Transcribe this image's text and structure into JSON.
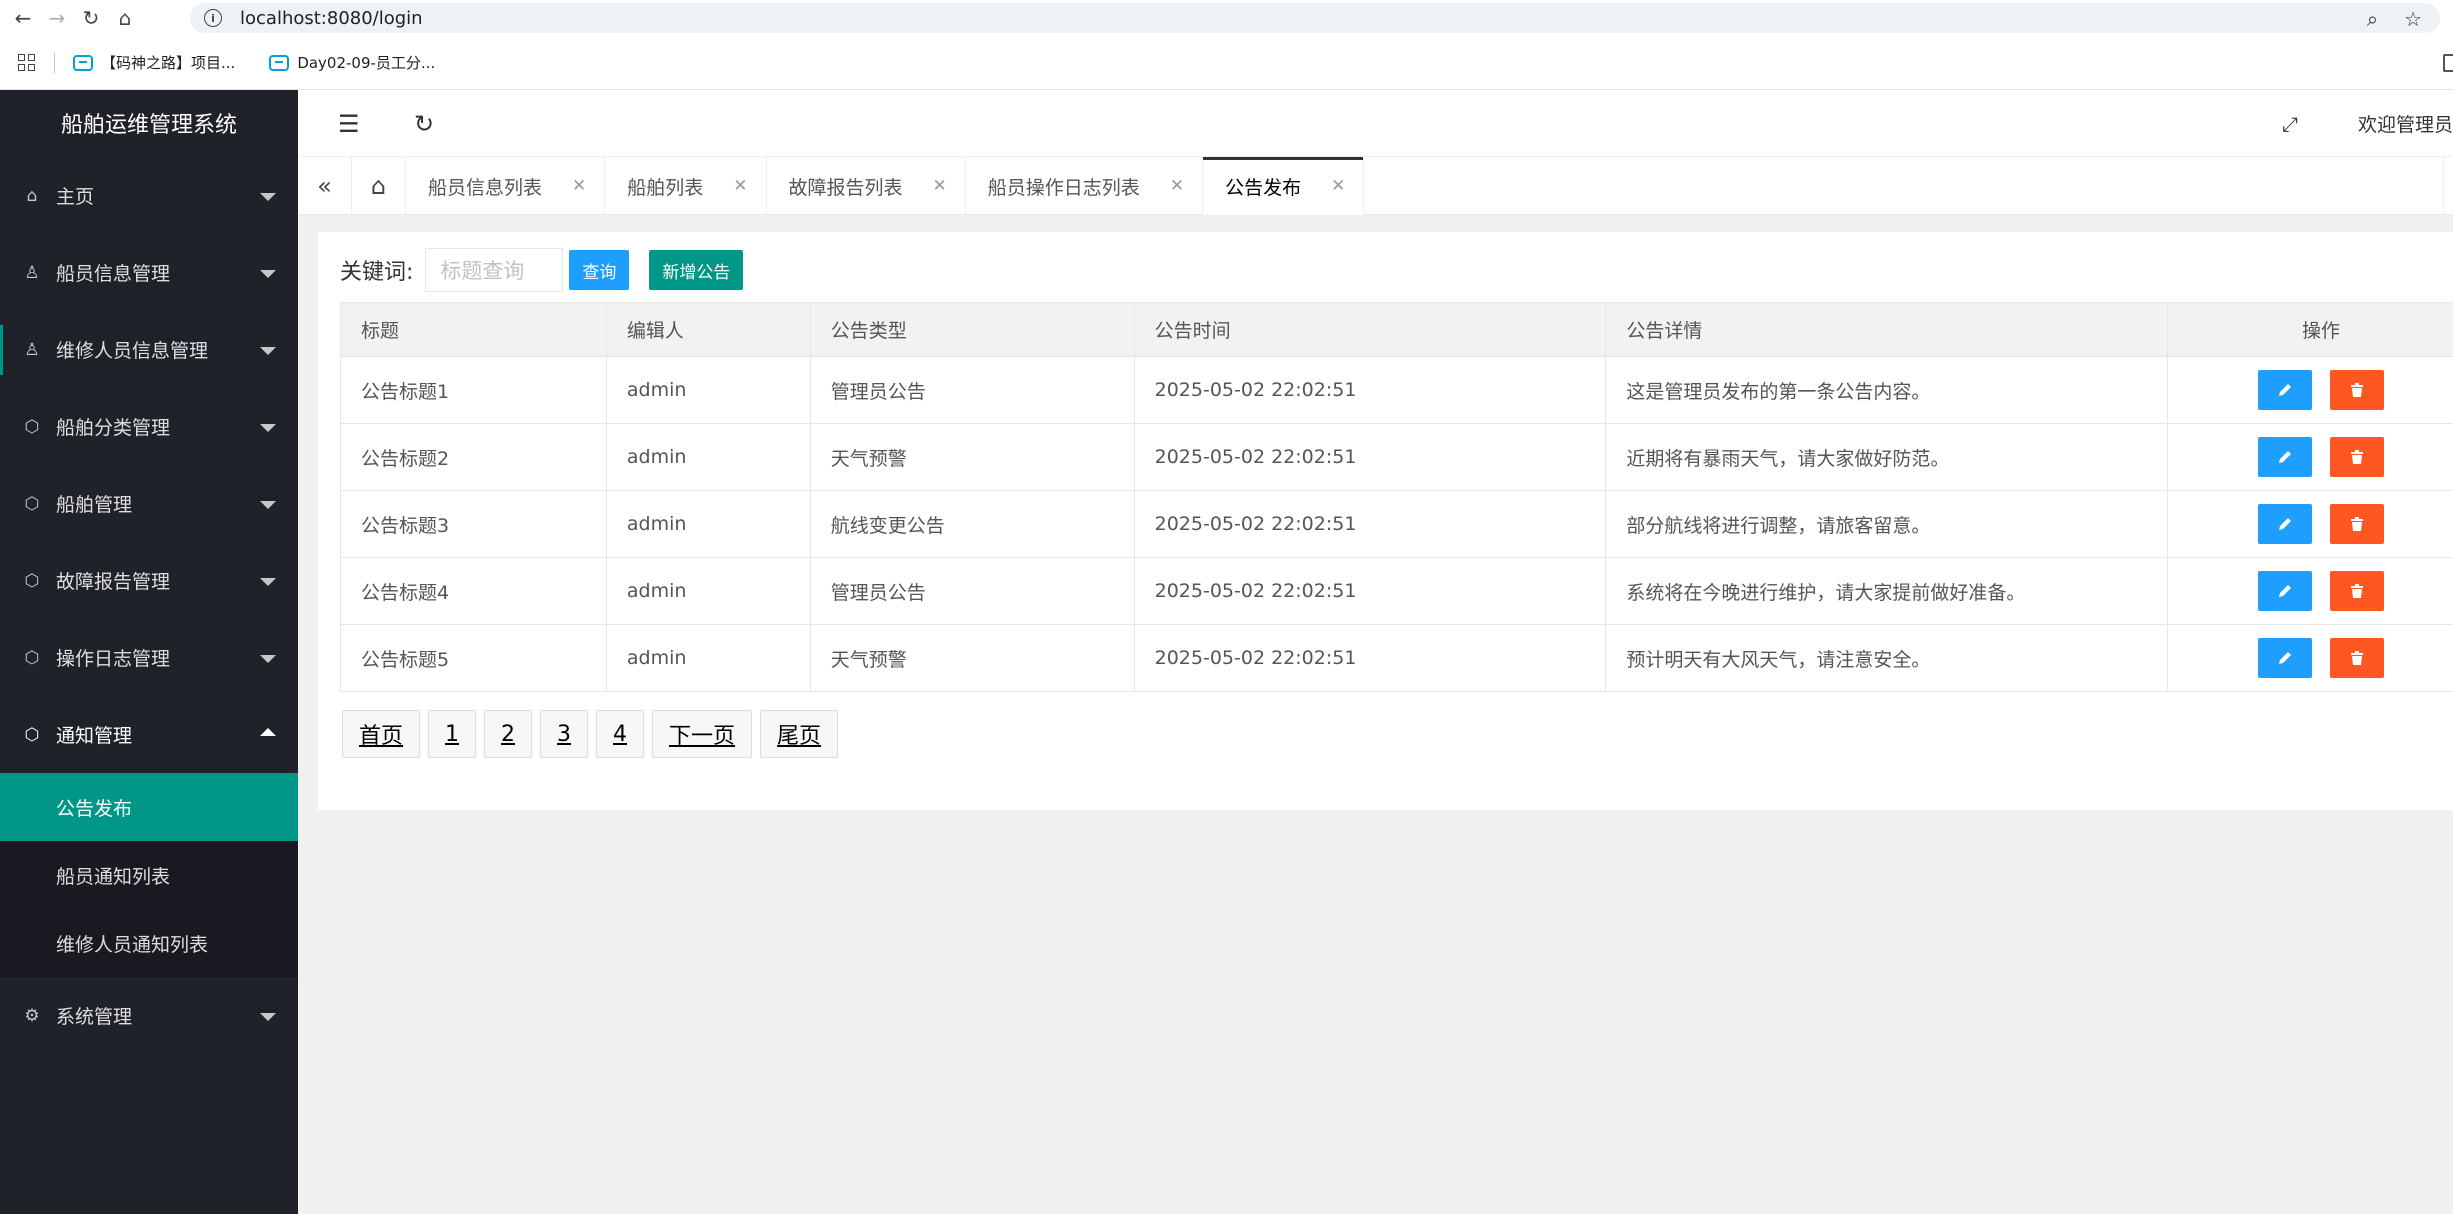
{
  "browser": {
    "url": "localhost:8080/login",
    "bookmarks": [
      "【码神之路】项目...",
      "Day02-09-员工分..."
    ]
  },
  "sidebar": {
    "title": "船舶运维管理系统",
    "items": [
      {
        "label": "主页",
        "icon": "home-icon"
      },
      {
        "label": "船员信息管理",
        "icon": "user-icon"
      },
      {
        "label": "维修人员信息管理",
        "icon": "user-icon"
      },
      {
        "label": "船舶分类管理",
        "icon": "cube-icon"
      },
      {
        "label": "船舶管理",
        "icon": "cube-icon"
      },
      {
        "label": "故障报告管理",
        "icon": "cube-icon"
      },
      {
        "label": "操作日志管理",
        "icon": "cube-icon"
      },
      {
        "label": "通知管理",
        "icon": "cube-icon"
      }
    ],
    "submenu": [
      "公告发布",
      "船员通知列表",
      "维修人员通知列表"
    ],
    "system": {
      "label": "系统管理",
      "icon": "gear-icon"
    }
  },
  "header": {
    "welcome": "欢迎管理员"
  },
  "tabs": [
    {
      "label": "船员信息列表"
    },
    {
      "label": "船舶列表"
    },
    {
      "label": "故障报告列表"
    },
    {
      "label": "船员操作日志列表"
    },
    {
      "label": "公告发布"
    }
  ],
  "toolbar": {
    "keyword_label": "关键词:",
    "search_placeholder": "标题查询",
    "query_label": "查询",
    "add_label": "新增公告"
  },
  "table": {
    "headers": [
      "标题",
      "编辑人",
      "公告类型",
      "公告时间",
      "公告详情",
      "操作"
    ],
    "rows": [
      [
        "公告标题1",
        "admin",
        "管理员公告",
        "2025-05-02 22:02:51",
        "这是管理员发布的第一条公告内容。"
      ],
      [
        "公告标题2",
        "admin",
        "天气预警",
        "2025-05-02 22:02:51",
        "近期将有暴雨天气，请大家做好防范。"
      ],
      [
        "公告标题3",
        "admin",
        "航线变更公告",
        "2025-05-02 22:02:51",
        "部分航线将进行调整，请旅客留意。"
      ],
      [
        "公告标题4",
        "admin",
        "管理员公告",
        "2025-05-02 22:02:51",
        "系统将在今晚进行维护，请大家提前做好准备。"
      ],
      [
        "公告标题5",
        "admin",
        "天气预警",
        "2025-05-02 22:02:51",
        "预计明天有大风天气，请注意安全。"
      ]
    ]
  },
  "pagination": [
    "首页",
    "1",
    "2",
    "3",
    "4",
    "下一页",
    "尾页"
  ],
  "colors": {
    "sidebar_bg": "#20222a",
    "active_green": "#009688",
    "primary_blue": "#1e9fff",
    "danger_orange": "#ff5722"
  }
}
